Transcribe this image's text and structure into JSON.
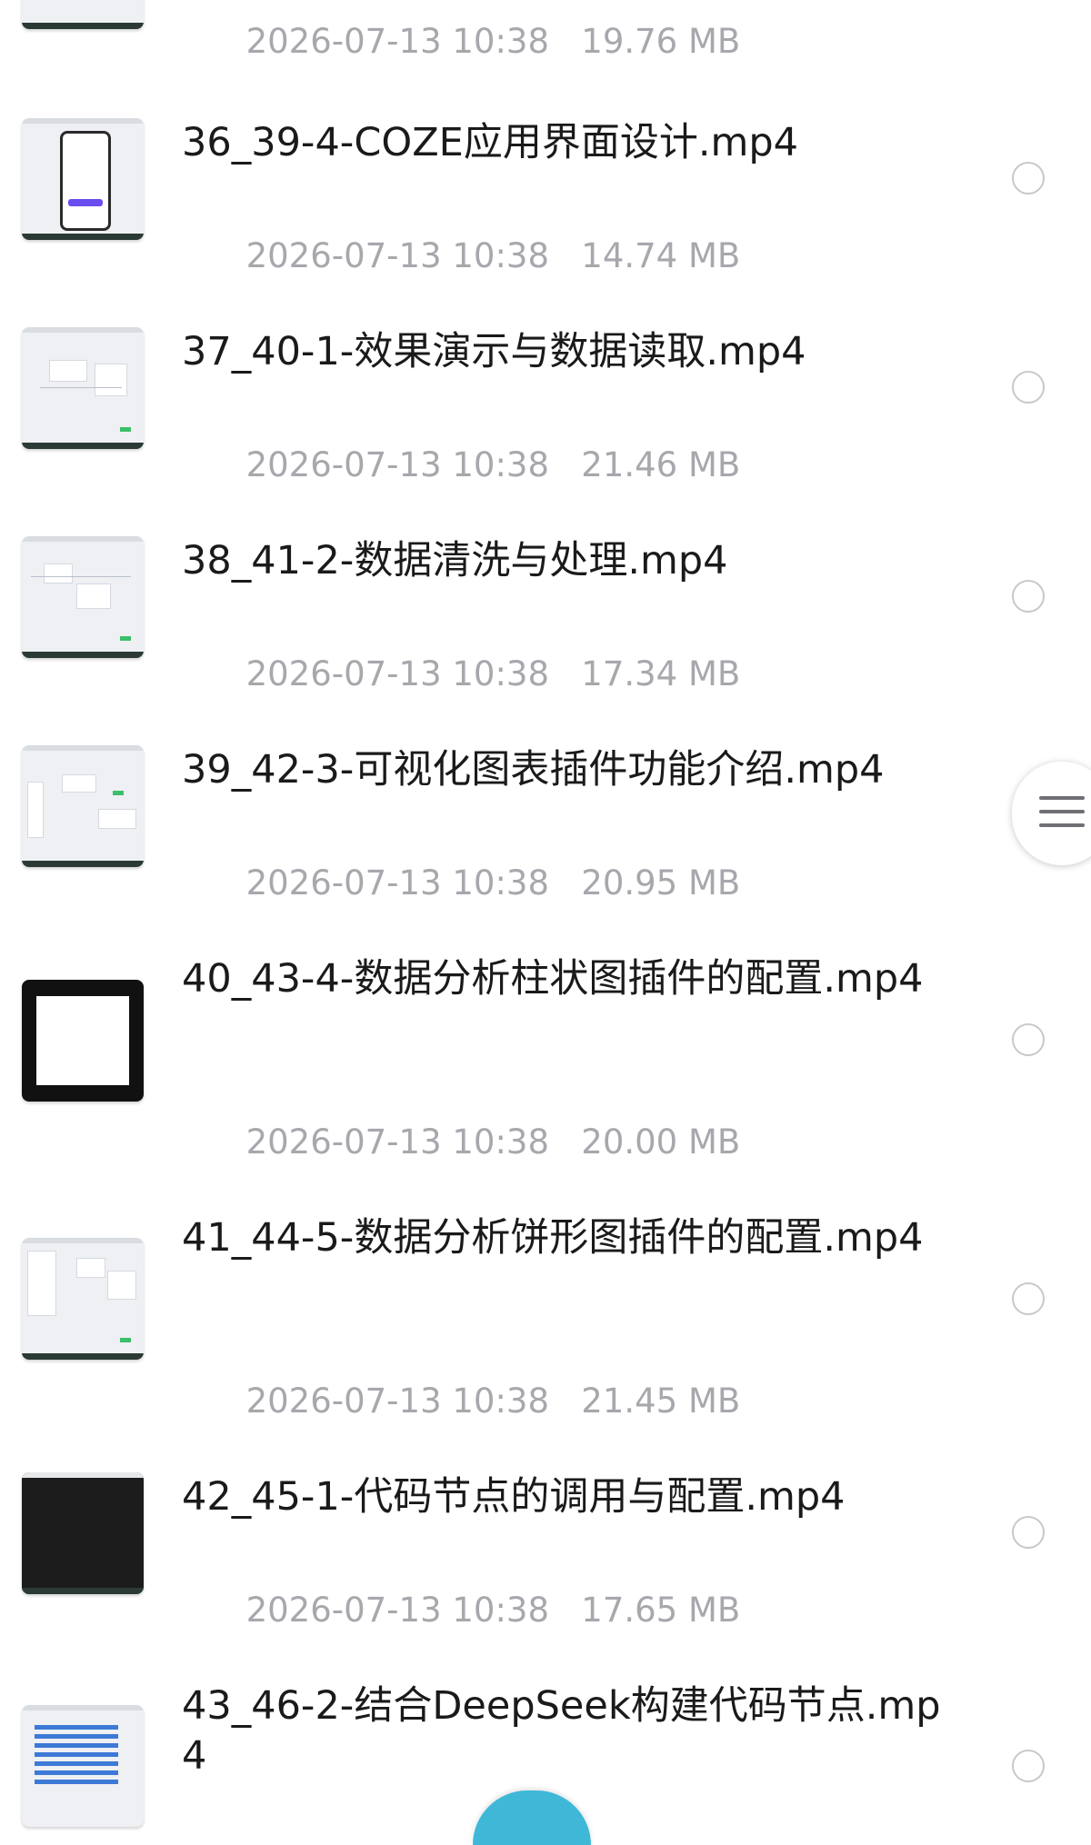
{
  "files": [
    {
      "name": "",
      "date": "2026-07-13 10:38",
      "size": "19.76 MB"
    },
    {
      "name": "36_39-4-COZE应用界面设计.mp4",
      "date": "2026-07-13 10:38",
      "size": "14.74 MB"
    },
    {
      "name": "37_40-1-效果演示与数据读取.mp4",
      "date": "2026-07-13 10:38",
      "size": "21.46 MB"
    },
    {
      "name": "38_41-2-数据清洗与处理.mp4",
      "date": "2026-07-13 10:38",
      "size": "17.34 MB"
    },
    {
      "name": "39_42-3-可视化图表插件功能介绍.mp4",
      "date": "2026-07-13 10:38",
      "size": "20.95 MB"
    },
    {
      "name": "40_43-4-数据分析柱状图插件的配置.mp4",
      "date": "2026-07-13 10:38",
      "size": "20.00 MB"
    },
    {
      "name": "41_44-5-数据分析饼形图插件的配置.mp4",
      "date": "2026-07-13 10:38",
      "size": "21.45 MB"
    },
    {
      "name": "42_45-1-代码节点的调用与配置.mp4",
      "date": "2026-07-13 10:38",
      "size": "17.65 MB"
    },
    {
      "name": "43_46-2-结合DeepSeek构建代码节点.mp4",
      "date": "",
      "size": ""
    }
  ],
  "icons": {
    "menu_handle": "menu-lines-icon",
    "selector": "radio-circle-icon"
  },
  "colors": {
    "title": "#1a1a1a",
    "meta": "#a7a7ad",
    "radio_border": "#c8c8cc",
    "fab": "#3fb8d8"
  }
}
